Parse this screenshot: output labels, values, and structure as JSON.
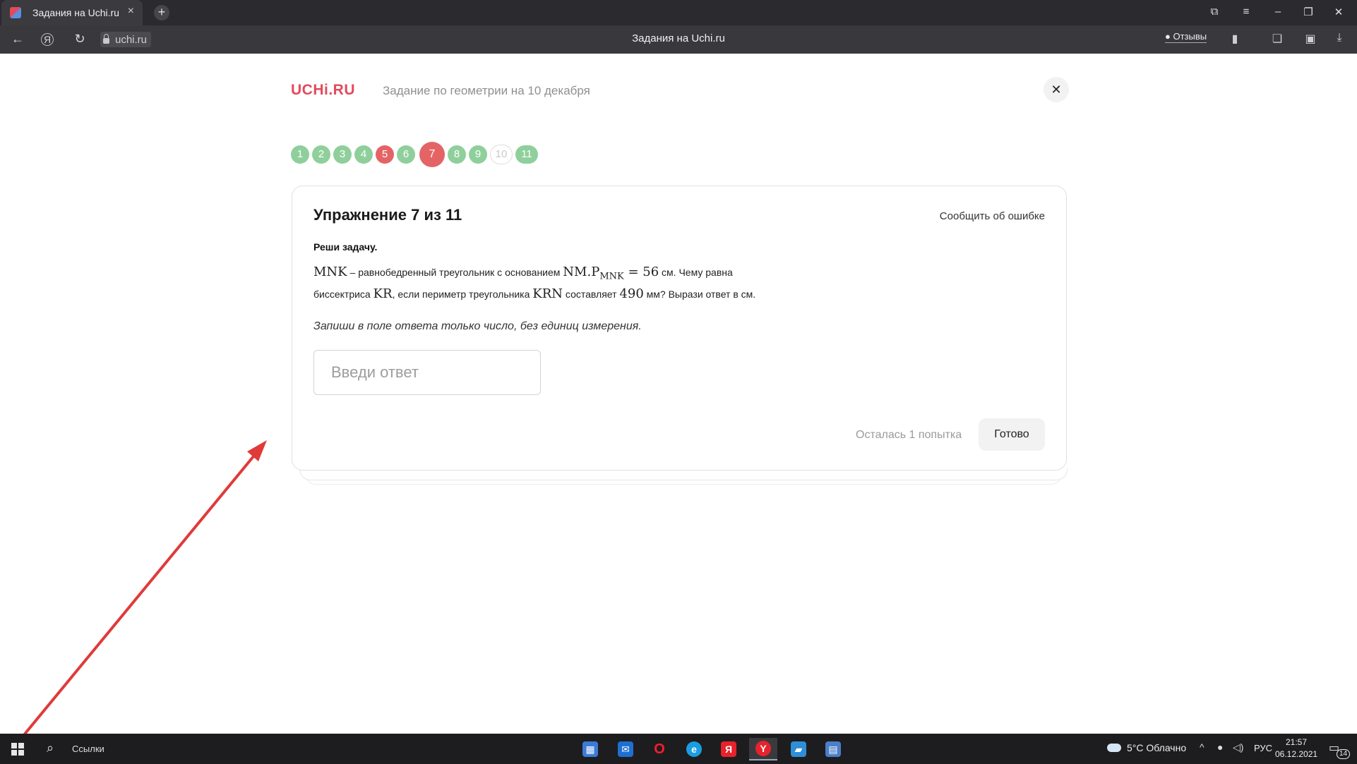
{
  "browser": {
    "tab_title": "Задания на Uchi.ru",
    "tab_close": "×",
    "new_tab": "+",
    "url": "uchi.ru",
    "page_title": "Задания на Uchi.ru",
    "reviews_label": "Отзывы",
    "icons": [
      "back-icon",
      "yandex-icon",
      "reload-icon",
      "lock-icon",
      "bookmark-icon",
      "collections-icon",
      "extensions-icon",
      "downloads-icon",
      "tabs-icon",
      "menu-icon",
      "minimize-icon",
      "restore-icon",
      "close-icon"
    ]
  },
  "header": {
    "logo": "UCHi.RU",
    "heading": "Задание по геометрии на 10 декабря",
    "close_symbol": "✕"
  },
  "steps": [
    {
      "label": "1",
      "state": "correct"
    },
    {
      "label": "2",
      "state": "correct"
    },
    {
      "label": "3",
      "state": "correct"
    },
    {
      "label": "4",
      "state": "correct"
    },
    {
      "label": "5",
      "state": "wrong"
    },
    {
      "label": "6",
      "state": "correct"
    },
    {
      "label": "7",
      "state": "current"
    },
    {
      "label": "8",
      "state": "correct"
    },
    {
      "label": "9",
      "state": "correct"
    },
    {
      "label": "10",
      "state": "empty"
    },
    {
      "label": "11",
      "state": "correct"
    }
  ],
  "exercise": {
    "title": "Упражнение 7 из 11",
    "report_link": "Сообщить об ошибке",
    "task_label": "Реши задачу.",
    "text": {
      "m1": "MNK",
      "t1": " – равнобедренный треугольник с основанием ",
      "m2": "NM.",
      "m3": "P",
      "m3_sub": "MNK",
      "m4": " = 56",
      "t2": " см. Чему равна",
      "t3": "биссектриса ",
      "m5": "KR",
      "t4": ", если периметр треугольника ",
      "m6": "KRN",
      "t5": " составляет ",
      "m7": "490",
      "t6": " мм? Вырази ответ в см."
    },
    "hint": "Запиши в поле ответа только число, без единиц измерения.",
    "input_placeholder": "Введи ответ",
    "input_value": "",
    "attempts": "Осталась 1 попытка",
    "submit": "Готово"
  },
  "colors": {
    "brand": "#e3495c",
    "step_correct": "#8fcf9b",
    "step_wrong": "#e46465",
    "arrow": "#e03a3a"
  },
  "taskbar": {
    "search_label": "Ссылки",
    "apps": [
      "store-icon",
      "mail-icon",
      "opera-icon",
      "edge-icon",
      "yandex-browser-icon",
      "yandex-browser-active-icon",
      "app-icon",
      "calculator-icon"
    ],
    "weather": "5°C  Облачно",
    "lang": "РУС",
    "time": "21:57",
    "date": "06.12.2021",
    "notifications": "14"
  }
}
